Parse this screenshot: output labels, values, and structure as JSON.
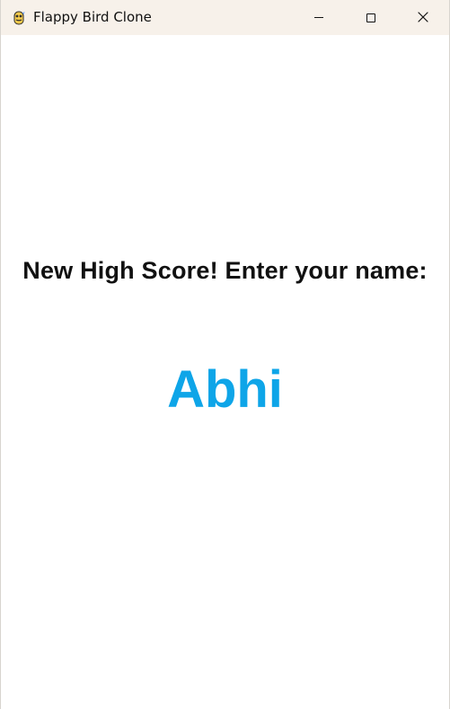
{
  "window": {
    "title": "Flappy Bird Clone",
    "app_icon": "pygame-snake-icon",
    "controls": {
      "minimize_icon": "minimize-icon",
      "maximize_icon": "maximize-icon",
      "close_icon": "close-icon"
    }
  },
  "game": {
    "prompt": "New High Score! Enter your name:",
    "name_value": "Abhi"
  },
  "colors": {
    "titlebar": "#f7f1ea",
    "background": "#ffffff",
    "prompt_text": "#111111",
    "name_text": "#0ea5e8"
  }
}
